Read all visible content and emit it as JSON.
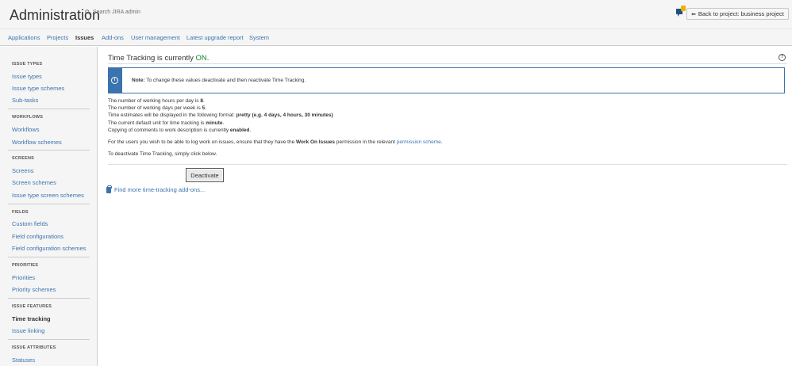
{
  "header": {
    "title": "Administration",
    "search_placeholder": "Search JIRA admin",
    "back_button": "Back to project: business project"
  },
  "nav": {
    "items": [
      "Applications",
      "Projects",
      "Issues",
      "Add-ons",
      "User management",
      "Latest upgrade report",
      "System"
    ],
    "active": "Issues"
  },
  "sidebar": {
    "sections": [
      {
        "heading": "ISSUE TYPES",
        "links": [
          "Issue types",
          "Issue type schemes",
          "Sub-tasks"
        ]
      },
      {
        "heading": "WORKFLOWS",
        "links": [
          "Workflows",
          "Workflow schemes"
        ]
      },
      {
        "heading": "SCREENS",
        "links": [
          "Screens",
          "Screen schemes",
          "Issue type screen schemes"
        ]
      },
      {
        "heading": "FIELDS",
        "links": [
          "Custom fields",
          "Field configurations",
          "Field configuration schemes"
        ]
      },
      {
        "heading": "PRIORITIES",
        "links": [
          "Priorities",
          "Priority schemes"
        ]
      },
      {
        "heading": "ISSUE FEATURES",
        "links": [
          "Time tracking",
          "Issue linking"
        ]
      },
      {
        "heading": "ISSUE ATTRIBUTES",
        "links": [
          "Statuses"
        ]
      }
    ],
    "active_link": "Time tracking"
  },
  "content": {
    "title_prefix": "Time Tracking is currently ",
    "status": "ON",
    "title_suffix": ".",
    "note_label": "Note:",
    "note_text": " To change these values deactivate and then reactivate Time Tracking.",
    "lines": {
      "hours_prefix": "The number of working hours per day is ",
      "hours_value": "8",
      "days_prefix": "The number of working days per week is ",
      "days_value": "5",
      "format_prefix": "Time estimates will be displayed in the following format: ",
      "format_value": "pretty (e.g. 4 days, 4 hours, 30 minutes)",
      "unit_prefix": "The current default unit for time tracking is ",
      "unit_value": "minute",
      "copy_prefix": "Copying of comments to work description is currently ",
      "copy_value": "enabled",
      "permission_prefix": "For the users you wish to be able to log work on issues, ensure that they have the ",
      "permission_bold": "Work On Issues",
      "permission_mid": " permission in the relevant ",
      "permission_link": "permission scheme",
      "deactivate_info": "To deactivate Time Tracking, simply click below."
    },
    "deactivate_button": "Deactivate",
    "addons_link": "Find more time-tracking add-ons..."
  }
}
